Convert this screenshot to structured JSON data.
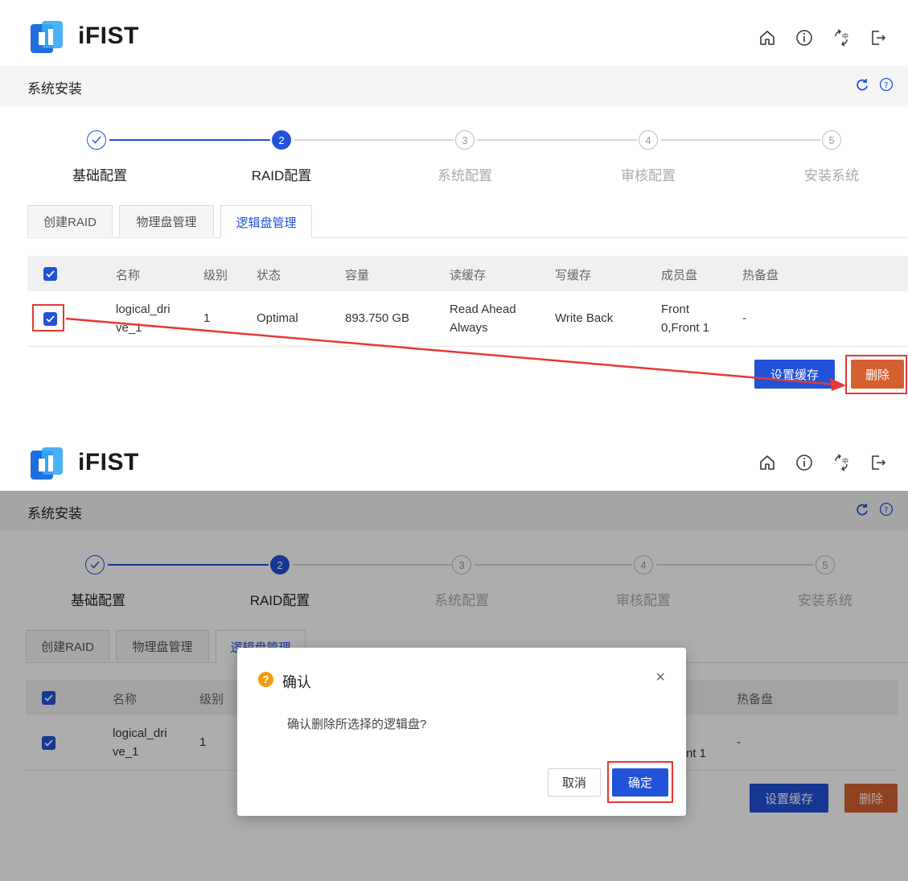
{
  "header": {
    "brand": "iFIST",
    "icons": [
      "home-icon",
      "info-icon",
      "language-icon",
      "logout-icon"
    ]
  },
  "titlebar": {
    "title": "系统安装",
    "icons": [
      "refresh-icon",
      "help-icon"
    ]
  },
  "steps": [
    {
      "number": "",
      "label": "基础配置",
      "state": "done"
    },
    {
      "number": "2",
      "label": "RAID配置",
      "state": "active"
    },
    {
      "number": "3",
      "label": "系统配置",
      "state": "pending"
    },
    {
      "number": "4",
      "label": "审核配置",
      "state": "pending"
    },
    {
      "number": "5",
      "label": "安装系统",
      "state": "pending"
    }
  ],
  "tabs": [
    {
      "label": "创建RAID"
    },
    {
      "label": "物理盘管理"
    },
    {
      "label": "逻辑盘管理",
      "active": true
    }
  ],
  "table": {
    "columns": [
      "名称",
      "级别",
      "状态",
      "容量",
      "读缓存",
      "写缓存",
      "成员盘",
      "热备盘"
    ],
    "rows": [
      {
        "name": "logical_dri ve_1",
        "name_line1": "logical_dri",
        "name_line2": "ve_1",
        "level": "1",
        "status": "Optimal",
        "capacity": "893.750 GB",
        "read_line1": "Read Ahead",
        "read_line2": "Always",
        "write": "Write Back",
        "member_line1": "Front",
        "member_line2": "0,Front 1",
        "member_partial": "nt 1",
        "hotspare": "-",
        "checked": true
      }
    ]
  },
  "actions": {
    "set_cache": "设置缓存",
    "delete": "删除"
  },
  "dialog": {
    "title": "确认",
    "icon": "question-icon",
    "message": "确认删除所选择的逻辑盘?",
    "cancel": "取消",
    "confirm": "确定",
    "close": "×"
  },
  "colors": {
    "primary": "#2152d8",
    "danger": "#d5602f",
    "highlight": "#e53935",
    "warning": "#f39c12"
  }
}
